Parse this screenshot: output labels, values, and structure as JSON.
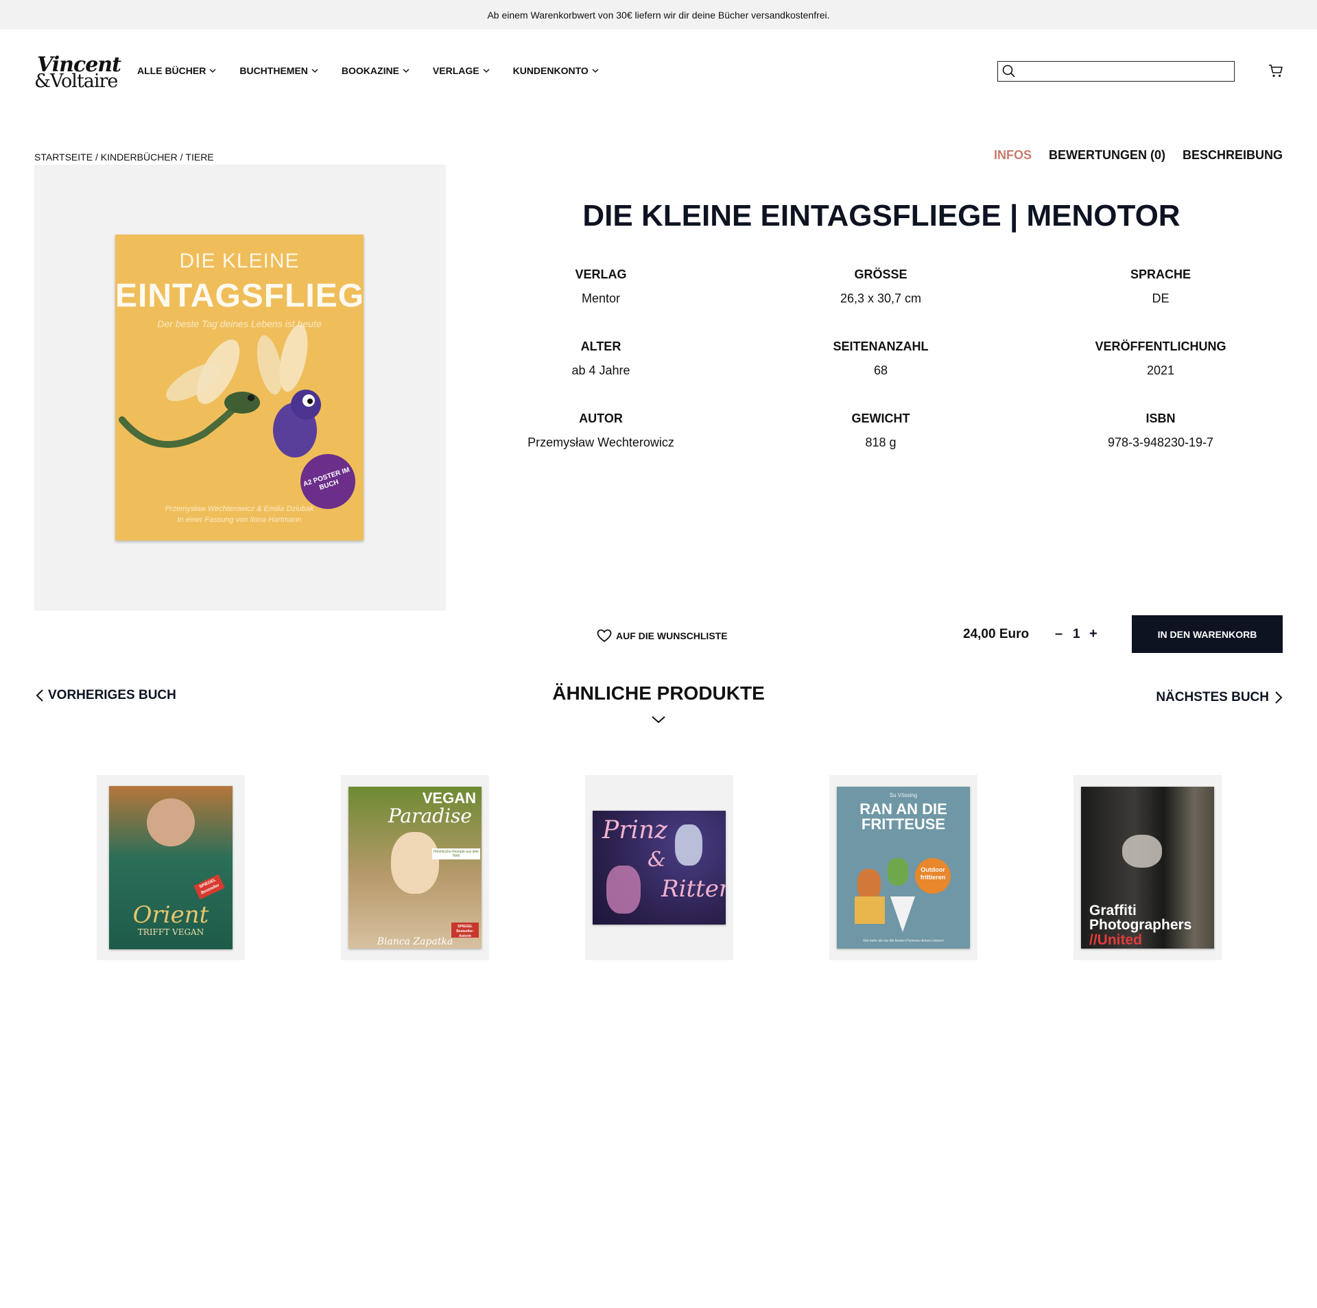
{
  "announcement": "Ab einem Warenkorbwert von 30€ liefern wir dir deine Bücher versandkostenfrei.",
  "logo": {
    "line1": "Vincent",
    "line2": "&Voltaire"
  },
  "nav": [
    {
      "label": "ALLE BÜCHER"
    },
    {
      "label": "BUCHTHEMEN"
    },
    {
      "label": "BOOKAZINE"
    },
    {
      "label": "VERLAGE"
    },
    {
      "label": "KUNDENKONTO"
    }
  ],
  "search": {
    "value": "",
    "placeholder": ""
  },
  "breadcrumb": {
    "items": [
      "STARTSEITE",
      "KINDERBÜCHER",
      "TIERE"
    ],
    "separator": " / "
  },
  "tabs": [
    {
      "label": "INFOS",
      "active": true
    },
    {
      "label": "BEWERTUNGEN (0)"
    },
    {
      "label": "BESCHREIBUNG"
    }
  ],
  "product": {
    "title": "DIE KLEINE EINTAGSFLIEGE | MENOTOR",
    "cover": {
      "line1": "DIE KLEINE",
      "line2": "EINTAGSFLIEGE",
      "tagline": "Der beste Tag deines Lebens ist heute",
      "badge": "A2 POSTER IM BUCH",
      "credits1": "Przemysław Wechterowicz & Emilia Dziubak",
      "credits2": "In einer Fassung von Ilona Hartmann"
    },
    "specs": [
      {
        "label": "VERLAG",
        "value": "Mentor"
      },
      {
        "label": "GRÖSSE",
        "value": "26,3 x 30,7 cm"
      },
      {
        "label": "SPRACHE",
        "value": "DE"
      },
      {
        "label": "ALTER",
        "value": "ab 4 Jahre"
      },
      {
        "label": "SEITENANZAHL",
        "value": "68"
      },
      {
        "label": "VERÖFFENTLICHUNG",
        "value": "2021"
      },
      {
        "label": "AUTOR",
        "value": "Przemysław Wechterowicz"
      },
      {
        "label": "GEWICHT",
        "value": "818 g"
      },
      {
        "label": "ISBN",
        "value": "978-3-948230-19-7"
      }
    ],
    "wishlist": "AUF DIE WUNSCHLISTE",
    "price": "24,00 Euro",
    "quantity": "1",
    "qty_minus": "–",
    "qty_plus": "+",
    "add_to_cart": "IN DEN WARENKORB"
  },
  "navigation": {
    "prev": "VORHERIGES BUCH",
    "next": "NÄCHSTES BUCH",
    "similar_heading": "ÄHNLICHE PRODUKTE"
  },
  "similar_products": [
    {
      "cover_title": "Orient",
      "cover_sub": "TRIFFT VEGAN",
      "badge": "SPIEGEL Bestseller",
      "color": "#1e5b4a"
    },
    {
      "cover_title": "VEGAN",
      "cover_sub": "Paradise",
      "author": "Bianca Zapatka",
      "badge": "SPIEGEL Bestseller-Autorin",
      "note": "Himmlische Rezepte aus aller Welt",
      "color": "#8a9a3c"
    },
    {
      "cover_title": "Prinz",
      "cover_amp": "&",
      "cover_sub": "Ritter",
      "color": "#2d2250"
    },
    {
      "cover_author": "Su Vössing",
      "cover_title": "RAN AN DIE FRITTEUSE",
      "badge": "Outdoor frittieren",
      "footer": "Viel mehr als nur die besten Pommes deines Lebens!",
      "color": "#6f97a6"
    },
    {
      "cover_title": "Graffiti Photographers",
      "cover_sub": "//United",
      "color": "#2b2a28"
    }
  ],
  "colors": {
    "accent": "#c97b6e",
    "dark": "#0d1321",
    "panel": "#f2f2f2"
  }
}
